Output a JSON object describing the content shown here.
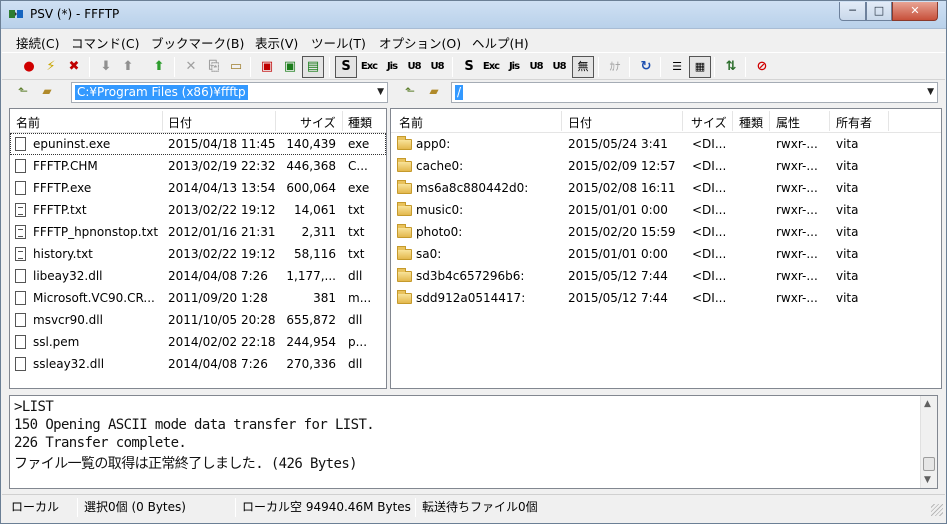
{
  "window": {
    "title": "PSV (*) - FFFTP",
    "minimize_label": "─",
    "maximize_label": "□",
    "close_label": "✕"
  },
  "menu": [
    "接続(C)",
    "コマンド(C)",
    "ブックマーク(B)",
    "表示(V)",
    "ツール(T)",
    "オプション(O)",
    "ヘルプ(H)"
  ],
  "toolbar": {
    "ascii_local": "Exc",
    "jis_local": "Jis",
    "utf8_local": "U8",
    "utf8n_local": "U8",
    "ascii_remote": "Exc",
    "jis_remote": "Jis",
    "utf8_remote": "U8",
    "utf8n_remote": "U8",
    "no_conv": "無",
    "kana": "ｶﾅ"
  },
  "local": {
    "path": "C:¥Program Files (x86)¥ffftp",
    "columns": {
      "name": "名前",
      "date": "日付",
      "size": "サイズ",
      "type": "種類"
    },
    "files": [
      {
        "name": "epuninst.exe",
        "date": "2015/04/18 11:45",
        "size": "140,439",
        "type": "exe",
        "icon": "file-icon"
      },
      {
        "name": "FFFTP.CHM",
        "date": "2013/02/19 22:32",
        "size": "446,368",
        "type": "C...",
        "icon": "file-icon"
      },
      {
        "name": "FFFTP.exe",
        "date": "2014/04/13 13:54",
        "size": "600,064",
        "type": "exe",
        "icon": "file-icon"
      },
      {
        "name": "FFFTP.txt",
        "date": "2013/02/22 19:12",
        "size": "14,061",
        "type": "txt",
        "icon": "text-file-icon"
      },
      {
        "name": "FFFTP_hpnonstop.txt",
        "date": "2012/01/16 21:31",
        "size": "2,311",
        "type": "txt",
        "icon": "text-file-icon"
      },
      {
        "name": "history.txt",
        "date": "2013/02/22 19:12",
        "size": "58,116",
        "type": "txt",
        "icon": "text-file-icon"
      },
      {
        "name": "libeay32.dll",
        "date": "2014/04/08  7:26",
        "size": "1,177,...",
        "type": "dll",
        "icon": "file-icon"
      },
      {
        "name": "Microsoft.VC90.CR...",
        "date": "2011/09/20  1:28",
        "size": "381",
        "type": "m...",
        "icon": "file-icon"
      },
      {
        "name": "msvcr90.dll",
        "date": "2011/10/05 20:28",
        "size": "655,872",
        "type": "dll",
        "icon": "file-icon"
      },
      {
        "name": "ssl.pem",
        "date": "2014/02/02 22:18",
        "size": "244,954",
        "type": "p...",
        "icon": "file-icon"
      },
      {
        "name": "ssleay32.dll",
        "date": "2014/04/08  7:26",
        "size": "270,336",
        "type": "dll",
        "icon": "file-icon"
      }
    ]
  },
  "remote": {
    "path": "/",
    "columns": {
      "name": "名前",
      "date": "日付",
      "size": "サイズ",
      "type": "種類",
      "attr": "属性",
      "owner": "所有者"
    },
    "files": [
      {
        "name": "app0:",
        "date": "2015/05/24  3:41",
        "size": "<DI...",
        "type": "",
        "attr": "rwxr-...",
        "owner": "vita"
      },
      {
        "name": "cache0:",
        "date": "2015/02/09 12:57",
        "size": "<DI...",
        "type": "",
        "attr": "rwxr-...",
        "owner": "vita"
      },
      {
        "name": "ms6a8c880442d0:",
        "date": "2015/02/08 16:11",
        "size": "<DI...",
        "type": "",
        "attr": "rwxr-...",
        "owner": "vita"
      },
      {
        "name": "music0:",
        "date": "2015/01/01  0:00",
        "size": "<DI...",
        "type": "",
        "attr": "rwxr-...",
        "owner": "vita"
      },
      {
        "name": "photo0:",
        "date": "2015/02/20 15:59",
        "size": "<DI...",
        "type": "",
        "attr": "rwxr-...",
        "owner": "vita"
      },
      {
        "name": "sa0:",
        "date": "2015/01/01  0:00",
        "size": "<DI...",
        "type": "",
        "attr": "rwxr-...",
        "owner": "vita"
      },
      {
        "name": "sd3b4c657296b6:",
        "date": "2015/05/12  7:44",
        "size": "<DI...",
        "type": "",
        "attr": "rwxr-...",
        "owner": "vita"
      },
      {
        "name": "sdd912a0514417:",
        "date": "2015/05/12  7:44",
        "size": "<DI...",
        "type": "",
        "attr": "rwxr-...",
        "owner": "vita"
      }
    ]
  },
  "log": [
    ">LIST",
    "150 Opening ASCII mode data transfer for LIST.",
    "226 Transfer complete.",
    "ファイル一覧の取得は正常終了しました. (426 Bytes)"
  ],
  "status": {
    "mode": "ローカル",
    "selection": "選択0個 (0 Bytes)",
    "free_space": "ローカル空 94940.46M Bytes",
    "queue": "転送待ちファイル0個"
  },
  "colors": {
    "selection": "#3399ff",
    "titlebar": "#b9d1ea",
    "close_button": "#c7503a"
  }
}
